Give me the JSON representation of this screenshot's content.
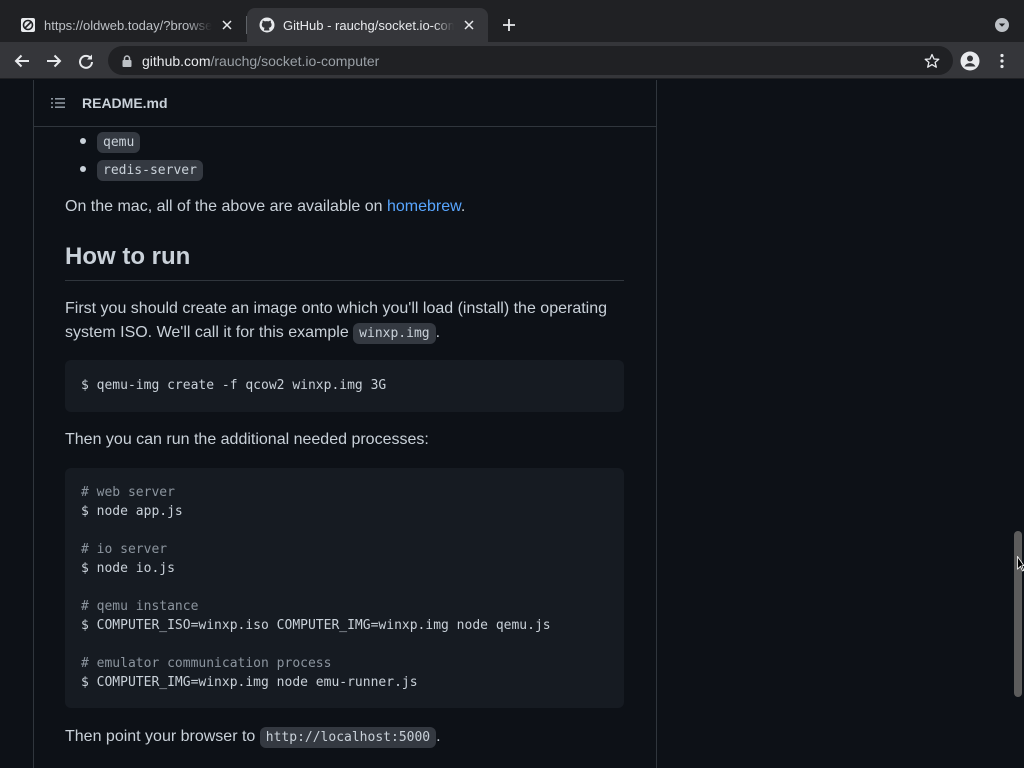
{
  "browser": {
    "tabs": [
      {
        "title": "https://oldweb.today/?browser",
        "favicon": "oldweb-favicon-icon",
        "active": false
      },
      {
        "title": "GitHub - rauchg/socket.io-com",
        "favicon": "github-icon",
        "active": true
      }
    ],
    "url_host": "github.com",
    "url_path": "/rauchg/socket.io-computer"
  },
  "readme": {
    "filename": "README.md",
    "bullets": [
      "qemu",
      "redis-server"
    ],
    "mac_text_before": "On the mac, all of the above are available on ",
    "mac_link": "homebrew",
    "mac_text_after": ".",
    "heading": "How to run",
    "intro_before": "First you should create an image onto which you'll load (install) the operating system ISO. We'll call it for this example ",
    "intro_code": "winxp.img",
    "intro_after": ".",
    "code1": "$ qemu-img create -f qcow2 winxp.img 3G",
    "run_text": "Then you can run the additional needed processes:",
    "code2": [
      {
        "comment": "# web server",
        "cmd": "$ node app.js"
      },
      {
        "comment": "# io server",
        "cmd": "$ node io.js"
      },
      {
        "comment": "# qemu instance",
        "cmd": "$ COMPUTER_ISO=winxp.iso COMPUTER_IMG=winxp.img node qemu.js"
      },
      {
        "comment": "# emulator communication process",
        "cmd": "$ COMPUTER_IMG=winxp.img node emu-runner.js"
      }
    ],
    "point_before": "Then point your browser to ",
    "point_code": "http://localhost:5000",
    "point_after": "."
  },
  "colors": {
    "page_bg": "#0d1117",
    "link": "#58a6ff",
    "code_bg": "#161b22",
    "border": "#30363d"
  }
}
